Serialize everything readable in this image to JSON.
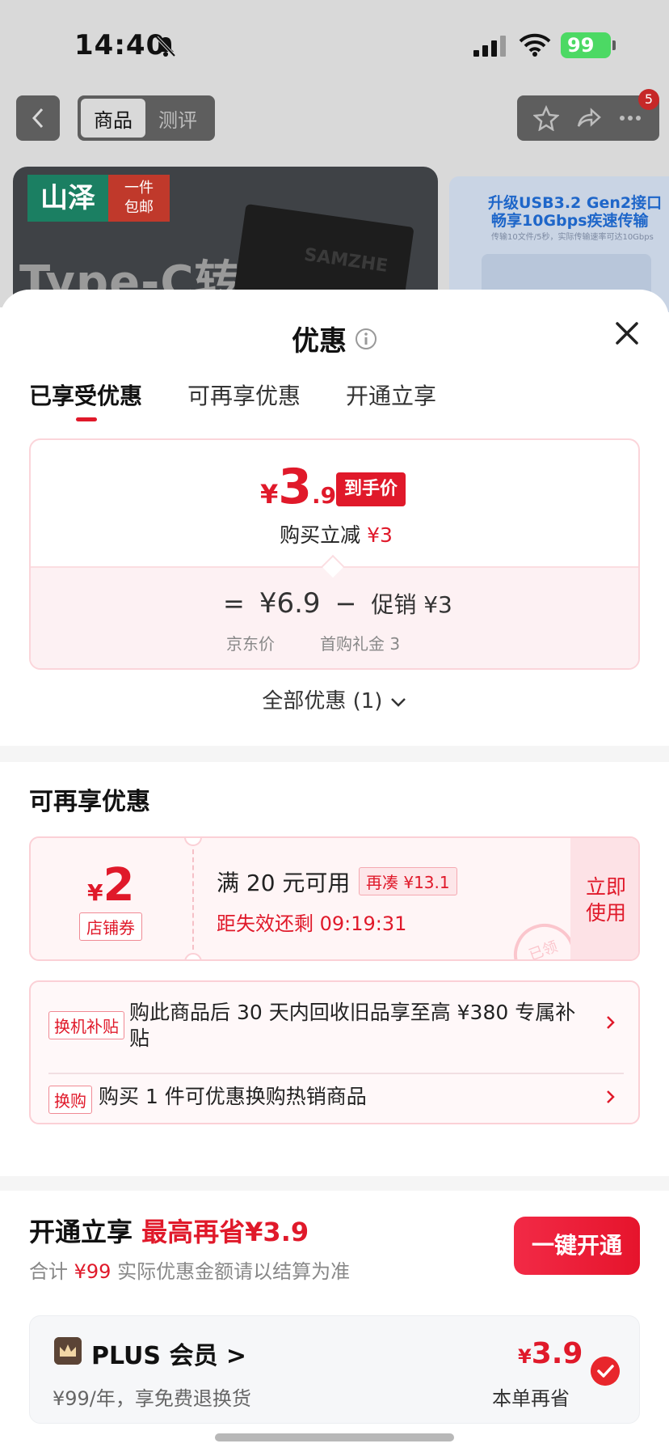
{
  "status_bar": {
    "time": "14:40",
    "battery": "99"
  },
  "nav": {
    "tabs": [
      "商品",
      "测评"
    ],
    "active_tab": 0,
    "badge": "5"
  },
  "banner": {
    "brand": "山泽",
    "brand_tag_line1": "一件",
    "brand_tag_line2": "包邮",
    "title": "Type-C转",
    "device_label": "SAMZHE"
  },
  "banner2": {
    "line1": "升级USB3.2 Gen2接口",
    "line2": "畅享10Gbps疾速传输",
    "small": "传输10文件/5秒，实际传输速率可达10Gbps"
  },
  "sheet": {
    "title": "优惠",
    "tabs": [
      "已享受优惠",
      "可再享优惠",
      "开通立享"
    ],
    "active_tab": 0
  },
  "price_card": {
    "yen": "¥",
    "int": "3",
    "dec": ".9",
    "tag": "到手价",
    "reduce_label": "购买立减",
    "reduce_value": "¥3",
    "eq": "=",
    "jd_price": "¥6.9",
    "minus": "−",
    "promo_value": "促销 ¥3",
    "jd_price_label": "京东价",
    "promo_label": "首购礼金 3"
  },
  "all_offers": "全部优惠 (1)",
  "more_section": {
    "title": "可再享优惠",
    "coupon": {
      "yen": "¥",
      "amount": "2",
      "type": "店铺券",
      "condition": "满 20 元可用",
      "gap": "再凑 ¥13.1",
      "timer": "距失效还剩 09:19:31",
      "use_line1": "立即",
      "use_line2": "使用",
      "stamp": "已领"
    },
    "promos": [
      {
        "tag": "换机补贴",
        "text": "购此商品后 30 天内回收旧品享至高 ¥380 专属补贴"
      },
      {
        "tag": "换购",
        "text": "购买 1 件可优惠换购热销商品"
      }
    ]
  },
  "open_section": {
    "title": "开通立享",
    "title_highlight": "最高再省¥3.9",
    "sub_label": "合计",
    "sub_price": "¥99",
    "sub_note": "实际优惠金额请以结算为准",
    "button": "一键开通",
    "plus": {
      "name": "PLUS 会员 >",
      "desc": "¥99/年，享免费退换货",
      "save_yen": "¥",
      "save": "3.9",
      "save_label": "本单再省"
    }
  },
  "colors": {
    "accent": "#e0192a",
    "brand_green": "#1b7f62"
  },
  "icons": [
    "bell-slash-icon",
    "signal-icon",
    "wifi-icon",
    "back-icon",
    "star-icon",
    "share-icon",
    "more-icon",
    "info-icon",
    "close-icon",
    "chevron-down-icon",
    "chevron-right-icon",
    "crown-icon",
    "check-icon"
  ]
}
